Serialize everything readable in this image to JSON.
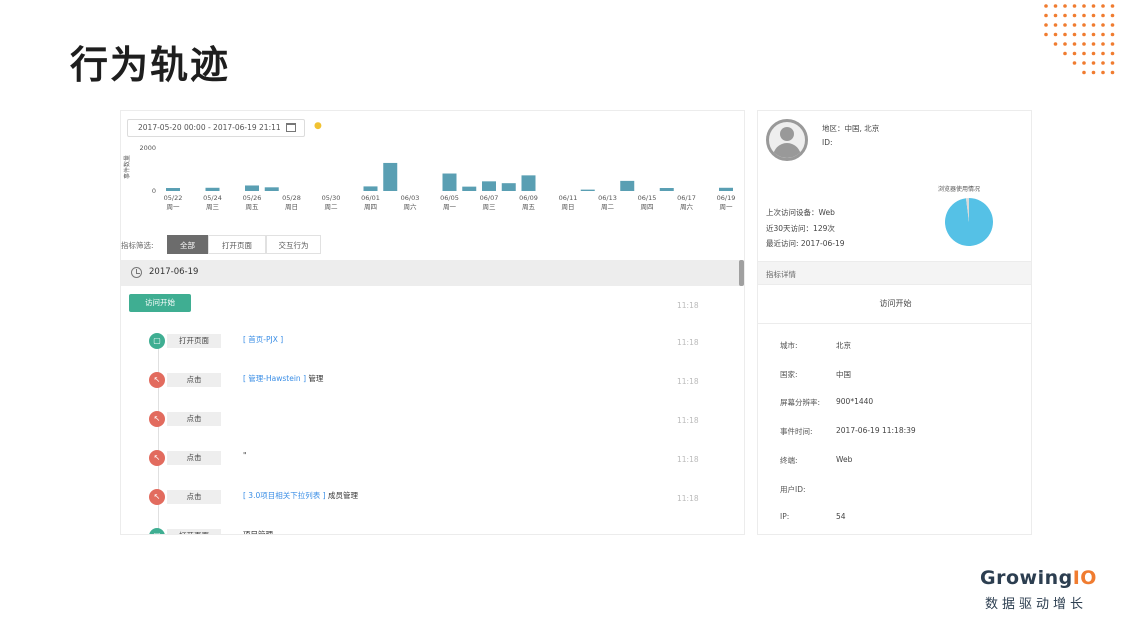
{
  "slide": {
    "title": "行为轨迹"
  },
  "brand": {
    "logo_text_a": "Growing",
    "logo_text_b": "IO",
    "tagline": "数据驱动增长",
    "accent": "#f07c30",
    "dark": "#2c3e50"
  },
  "filters": {
    "date_range": "2017-05-20 00:00 - 2017-06-19 21:11",
    "label": "指标筛选:",
    "tabs": [
      "全部",
      "打开页面",
      "交互行为"
    ],
    "active_tab": "全部"
  },
  "chart_data": {
    "type": "bar",
    "ylabel": "事件数量",
    "ylim": [
      0,
      2000
    ],
    "yticks": [
      "2000",
      "0"
    ],
    "x_tick_dates": [
      "05/22",
      "05/24",
      "05/26",
      "05/28",
      "05/30",
      "06/01",
      "06/03",
      "06/05",
      "06/07",
      "06/09",
      "06/11",
      "06/13",
      "06/15",
      "06/17",
      "06/19"
    ],
    "x_tick_days": [
      "周一",
      "周三",
      "周五",
      "周日",
      "周二",
      "周四",
      "周六",
      "周一",
      "周三",
      "周五",
      "周日",
      "周二",
      "周四",
      "周六",
      "周一"
    ],
    "categories": [
      "05/22",
      "05/23",
      "05/24",
      "05/25",
      "05/26",
      "05/27",
      "05/28",
      "05/29",
      "05/30",
      "05/31",
      "06/01",
      "06/02",
      "06/03",
      "06/04",
      "06/05",
      "06/06",
      "06/07",
      "06/08",
      "06/09",
      "06/10",
      "06/11",
      "06/12",
      "06/13",
      "06/14",
      "06/15",
      "06/16",
      "06/17",
      "06/18",
      "06/19"
    ],
    "values": [
      130,
      0,
      140,
      0,
      240,
      160,
      0,
      0,
      0,
      0,
      200,
      1220,
      0,
      0,
      760,
      190,
      420,
      340,
      680,
      0,
      0,
      60,
      0,
      440,
      0,
      130,
      0,
      0,
      140
    ],
    "bar_color": "#5a9fb3",
    "grid": false
  },
  "timeline": {
    "date": "2017-06-19",
    "start_label": "访问开始",
    "start_time": "11:18",
    "events": [
      {
        "type": "打开页面",
        "kind": "page",
        "link": "[ 首页-PJX ]",
        "suffix": "",
        "time": "11:18"
      },
      {
        "type": "点击",
        "kind": "click",
        "link": "[ 管理-Hawstein ]",
        "suffix": " 管理",
        "time": "11:18"
      },
      {
        "type": "点击",
        "kind": "click",
        "link": "",
        "suffix": "",
        "time": "11:18"
      },
      {
        "type": "点击",
        "kind": "click",
        "link": "",
        "suffix": "\"",
        "time": "11:18"
      },
      {
        "type": "点击",
        "kind": "click",
        "link": "[ 3.0项目相关下拉列表 ]",
        "suffix": " 成员管理",
        "time": "11:18"
      },
      {
        "type": "打开页面",
        "kind": "page",
        "link": "",
        "suffix": "项目管理",
        "time": ""
      }
    ]
  },
  "user": {
    "region": "地区：中国, 北京",
    "id": "ID:",
    "last_device": "上次访问设备：Web",
    "visits_30d": "近30天访问：129次",
    "last_visit": "最近访问: 2017-06-19",
    "pie_title": "浏览器使用情况",
    "pie_values": [
      98,
      2
    ],
    "pie_colors": [
      "#55c1e6",
      "#d9d9d9"
    ]
  },
  "detail": {
    "header": "指标详情",
    "title": "访问开始",
    "rows": [
      {
        "label": "城市:",
        "value": "北京"
      },
      {
        "label": "国家:",
        "value": "中国"
      },
      {
        "label": "屏幕分辨率:",
        "value": "900*1440"
      },
      {
        "label": "事件时间:",
        "value": "2017-06-19 11:18:39"
      },
      {
        "label": "终端:",
        "value": "Web"
      },
      {
        "label": "用户ID:",
        "value": ""
      },
      {
        "label": "IP:",
        "value": "54"
      }
    ]
  }
}
